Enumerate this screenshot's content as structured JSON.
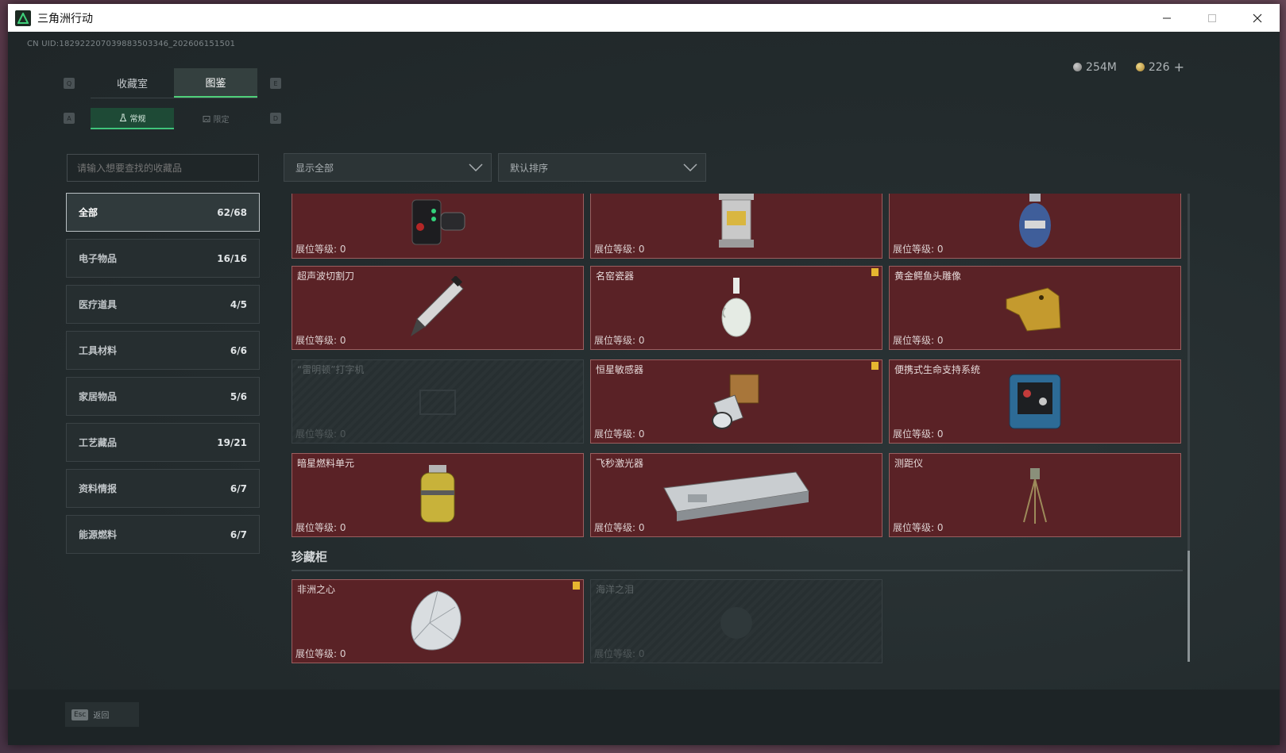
{
  "window": {
    "title": "三角洲行动"
  },
  "header": {
    "uid": "CN UID:1829222070398835033​46_202606151501",
    "currency": [
      {
        "icon": "silver-coin-icon",
        "value": "254M"
      },
      {
        "icon": "gold-coin-icon",
        "value": "226"
      }
    ],
    "add_label": "+"
  },
  "tabs": {
    "left_key": "Q",
    "right_key": "E",
    "items": [
      {
        "label": "收藏室"
      },
      {
        "label": "图鉴"
      }
    ],
    "sub_left_key": "A",
    "sub_right_key": "D",
    "sub_items": [
      {
        "label": "常规"
      },
      {
        "label": "限定"
      }
    ]
  },
  "search": {
    "placeholder": "请输入想要查找的收藏品"
  },
  "categories": [
    {
      "label": "全部",
      "count": "62/68"
    },
    {
      "label": "电子物品",
      "count": "16/16"
    },
    {
      "label": "医疗道具",
      "count": "4/5"
    },
    {
      "label": "工具材料",
      "count": "6/6"
    },
    {
      "label": "家居物品",
      "count": "5/6"
    },
    {
      "label": "工艺藏品",
      "count": "19/21"
    },
    {
      "label": "资料情报",
      "count": "6/7"
    },
    {
      "label": "能源燃料",
      "count": "6/7"
    }
  ],
  "filters": {
    "show_all": "显示全部",
    "sort": "默认排序"
  },
  "items": [
    {
      "name": "",
      "level": "展位等级: 0"
    },
    {
      "name": "",
      "level": "展位等级: 0"
    },
    {
      "name": "",
      "level": "展位等级: 0"
    },
    {
      "name": "超声波切割刀",
      "level": "展位等级: 0"
    },
    {
      "name": "名窑瓷器",
      "level": "展位等级: 0"
    },
    {
      "name": "黄金鳄鱼头雕像",
      "level": "展位等级: 0"
    },
    {
      "name": "“雷明顿”打字机",
      "level": "展位等级: 0"
    },
    {
      "name": "恒星敏感器",
      "level": "展位等级: 0"
    },
    {
      "name": "便携式生命支持系统",
      "level": "展位等级: 0"
    },
    {
      "name": "暗星燃料单元",
      "level": "展位等级: 0"
    },
    {
      "name": "飞秒激光器",
      "level": "展位等级: 0"
    },
    {
      "name": "测距仪",
      "level": "展位等级: 0"
    }
  ],
  "vault": {
    "title": "珍藏柜",
    "items": [
      {
        "name": "非洲之心",
        "level": "展位等级: 0"
      },
      {
        "name": "海洋之泪",
        "level": "展位等级: 0"
      }
    ]
  },
  "footer": {
    "esc_key": "Esc",
    "back_label": "返回"
  }
}
